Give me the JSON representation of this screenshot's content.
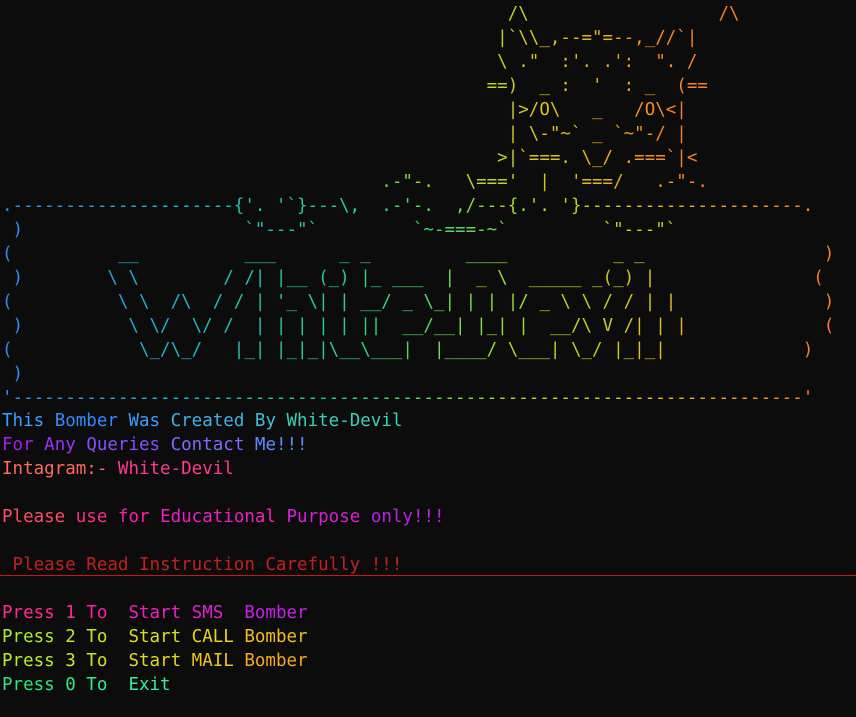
{
  "banner": {
    "ascii_art": [
      "                                                /\\                  /\\",
      "                                               |`\\\\_,--=\"=--,_//`|",
      "                                               \\ .\"  :'. .':  \". /",
      "                                              ==)  _ :  '  : _  (==",
      "                                                |>/O\\   _   /O\\<|",
      "                                                | \\-\"~` _ `~\"-/ |",
      "                                               >|`===. \\_/ .===`|<",
      "                                    .-\"-.   \\==='  |  '===/   .-\"-.",
      ".---------------------{'. '`}---\\,  .-'-.  ,/---{.'. '}---------------------.",
      " )                     `\"---\"`         `~-===-~`         `\"---\"`                     (",
      "(          __          ___      _ _         ____          _ _                 )",
      " )        \\ \\        / /| |__ (_) |_ ___  |  _ \\  _____ _(_) |               (",
      "(          \\ \\  /\\  / / | '_ \\| | __/ _ \\_| | | |/ _ \\ \\ / / | |              )",
      " )          \\ \\/  \\/ /  | | | | | ||  __/__| |_| |  __/\\ V /| | |             (",
      "(            \\_/\\_/   |_| |_|_|\\__\\___|  |____/ \\___| \\_/ |_|_|             )",
      " )                                                                                  (",
      "'---------------------------------------------------------------------------'"
    ]
  },
  "info": {
    "line1": [
      {
        "text": "This ",
        "color": "#3aa0ff"
      },
      {
        "text": "Bomber ",
        "color": "#2f8cff"
      },
      {
        "text": "Was ",
        "color": "#3aa0ff"
      },
      {
        "text": "Created ",
        "color": "#3fb0e8"
      },
      {
        "text": "By ",
        "color": "#3fc0d8"
      },
      {
        "text": "White-Devil",
        "color": "#38d0b8"
      }
    ],
    "line2": [
      {
        "text": "For ",
        "color": "#a020f0"
      },
      {
        "text": "Any ",
        "color": "#9b30ff"
      },
      {
        "text": "Queries ",
        "color": "#8a4bff"
      },
      {
        "text": "Contact ",
        "color": "#7b6cff"
      },
      {
        "text": "Me!!!",
        "color": "#5a8cff"
      }
    ],
    "line3": [
      {
        "text": "Intagram:- ",
        "color": "#ff6a5a"
      },
      {
        "text": "White-Devil",
        "color": "#ff3a8c"
      }
    ],
    "line4": [
      {
        "text": "Please ",
        "color": "#ff4a6a"
      },
      {
        "text": "use ",
        "color": "#ff2a8c"
      },
      {
        "text": "for ",
        "color": "#ff1fa8"
      },
      {
        "text": "Educational ",
        "color": "#f21fc0"
      },
      {
        "text": "Purpose ",
        "color": "#d81fd8"
      },
      {
        "text": "only!!!",
        "color": "#b81ff0"
      }
    ]
  },
  "warning": {
    "text": " Please Read Instruction Carefully !!!",
    "color": "#c22020"
  },
  "menu": {
    "line1": [
      {
        "text": "Press ",
        "color": "#ff2a8c"
      },
      {
        "text": "1 ",
        "color": "#ff2a9c"
      },
      {
        "text": "To  ",
        "color": "#ff1fa8"
      },
      {
        "text": "Start ",
        "color": "#f21fc0"
      },
      {
        "text": "SMS  ",
        "color": "#e01fd0"
      },
      {
        "text": "Bomber",
        "color": "#c81fe8"
      }
    ],
    "line2": [
      {
        "text": "Press ",
        "color": "#a8f028"
      },
      {
        "text": "2 ",
        "color": "#b4ec24"
      },
      {
        "text": "To  ",
        "color": "#c8e820"
      },
      {
        "text": "Start ",
        "color": "#d8e01c"
      },
      {
        "text": "CALL ",
        "color": "#e8d418"
      },
      {
        "text": "Bomber",
        "color": "#f0c018"
      }
    ],
    "line3": [
      {
        "text": "Press ",
        "color": "#b8f024"
      },
      {
        "text": "3 ",
        "color": "#c4ec22"
      },
      {
        "text": "To  ",
        "color": "#d4e41e"
      },
      {
        "text": "Start ",
        "color": "#e4d81a"
      },
      {
        "text": "MAIL ",
        "color": "#f0c418"
      },
      {
        "text": "Bomber",
        "color": "#f8a820"
      }
    ],
    "line4": [
      {
        "text": "Press ",
        "color": "#28e878"
      },
      {
        "text": "0 ",
        "color": "#2cea84"
      },
      {
        "text": "To  ",
        "color": "#30ec90"
      },
      {
        "text": "Exit",
        "color": "#34ee9c"
      }
    ]
  }
}
